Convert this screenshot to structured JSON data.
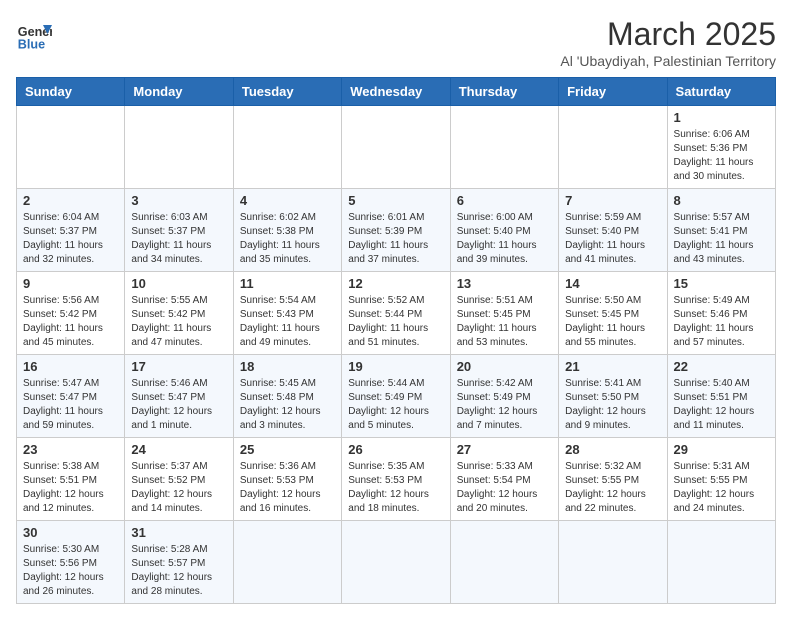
{
  "header": {
    "logo_text_general": "General",
    "logo_text_blue": "Blue",
    "month_title": "March 2025",
    "subtitle": "Al 'Ubaydiyah, Palestinian Territory"
  },
  "weekdays": [
    "Sunday",
    "Monday",
    "Tuesday",
    "Wednesday",
    "Thursday",
    "Friday",
    "Saturday"
  ],
  "weeks": [
    [
      {
        "day": "",
        "sunrise": "",
        "sunset": "",
        "daylight": ""
      },
      {
        "day": "",
        "sunrise": "",
        "sunset": "",
        "daylight": ""
      },
      {
        "day": "",
        "sunrise": "",
        "sunset": "",
        "daylight": ""
      },
      {
        "day": "",
        "sunrise": "",
        "sunset": "",
        "daylight": ""
      },
      {
        "day": "",
        "sunrise": "",
        "sunset": "",
        "daylight": ""
      },
      {
        "day": "",
        "sunrise": "",
        "sunset": "",
        "daylight": ""
      },
      {
        "day": "1",
        "sunrise": "Sunrise: 6:06 AM",
        "sunset": "Sunset: 5:36 PM",
        "daylight": "Daylight: 11 hours and 30 minutes."
      }
    ],
    [
      {
        "day": "2",
        "sunrise": "Sunrise: 6:04 AM",
        "sunset": "Sunset: 5:37 PM",
        "daylight": "Daylight: 11 hours and 32 minutes."
      },
      {
        "day": "3",
        "sunrise": "Sunrise: 6:03 AM",
        "sunset": "Sunset: 5:37 PM",
        "daylight": "Daylight: 11 hours and 34 minutes."
      },
      {
        "day": "4",
        "sunrise": "Sunrise: 6:02 AM",
        "sunset": "Sunset: 5:38 PM",
        "daylight": "Daylight: 11 hours and 35 minutes."
      },
      {
        "day": "5",
        "sunrise": "Sunrise: 6:01 AM",
        "sunset": "Sunset: 5:39 PM",
        "daylight": "Daylight: 11 hours and 37 minutes."
      },
      {
        "day": "6",
        "sunrise": "Sunrise: 6:00 AM",
        "sunset": "Sunset: 5:40 PM",
        "daylight": "Daylight: 11 hours and 39 minutes."
      },
      {
        "day": "7",
        "sunrise": "Sunrise: 5:59 AM",
        "sunset": "Sunset: 5:40 PM",
        "daylight": "Daylight: 11 hours and 41 minutes."
      },
      {
        "day": "8",
        "sunrise": "Sunrise: 5:57 AM",
        "sunset": "Sunset: 5:41 PM",
        "daylight": "Daylight: 11 hours and 43 minutes."
      }
    ],
    [
      {
        "day": "9",
        "sunrise": "Sunrise: 5:56 AM",
        "sunset": "Sunset: 5:42 PM",
        "daylight": "Daylight: 11 hours and 45 minutes."
      },
      {
        "day": "10",
        "sunrise": "Sunrise: 5:55 AM",
        "sunset": "Sunset: 5:42 PM",
        "daylight": "Daylight: 11 hours and 47 minutes."
      },
      {
        "day": "11",
        "sunrise": "Sunrise: 5:54 AM",
        "sunset": "Sunset: 5:43 PM",
        "daylight": "Daylight: 11 hours and 49 minutes."
      },
      {
        "day": "12",
        "sunrise": "Sunrise: 5:52 AM",
        "sunset": "Sunset: 5:44 PM",
        "daylight": "Daylight: 11 hours and 51 minutes."
      },
      {
        "day": "13",
        "sunrise": "Sunrise: 5:51 AM",
        "sunset": "Sunset: 5:45 PM",
        "daylight": "Daylight: 11 hours and 53 minutes."
      },
      {
        "day": "14",
        "sunrise": "Sunrise: 5:50 AM",
        "sunset": "Sunset: 5:45 PM",
        "daylight": "Daylight: 11 hours and 55 minutes."
      },
      {
        "day": "15",
        "sunrise": "Sunrise: 5:49 AM",
        "sunset": "Sunset: 5:46 PM",
        "daylight": "Daylight: 11 hours and 57 minutes."
      }
    ],
    [
      {
        "day": "16",
        "sunrise": "Sunrise: 5:47 AM",
        "sunset": "Sunset: 5:47 PM",
        "daylight": "Daylight: 11 hours and 59 minutes."
      },
      {
        "day": "17",
        "sunrise": "Sunrise: 5:46 AM",
        "sunset": "Sunset: 5:47 PM",
        "daylight": "Daylight: 12 hours and 1 minute."
      },
      {
        "day": "18",
        "sunrise": "Sunrise: 5:45 AM",
        "sunset": "Sunset: 5:48 PM",
        "daylight": "Daylight: 12 hours and 3 minutes."
      },
      {
        "day": "19",
        "sunrise": "Sunrise: 5:44 AM",
        "sunset": "Sunset: 5:49 PM",
        "daylight": "Daylight: 12 hours and 5 minutes."
      },
      {
        "day": "20",
        "sunrise": "Sunrise: 5:42 AM",
        "sunset": "Sunset: 5:49 PM",
        "daylight": "Daylight: 12 hours and 7 minutes."
      },
      {
        "day": "21",
        "sunrise": "Sunrise: 5:41 AM",
        "sunset": "Sunset: 5:50 PM",
        "daylight": "Daylight: 12 hours and 9 minutes."
      },
      {
        "day": "22",
        "sunrise": "Sunrise: 5:40 AM",
        "sunset": "Sunset: 5:51 PM",
        "daylight": "Daylight: 12 hours and 11 minutes."
      }
    ],
    [
      {
        "day": "23",
        "sunrise": "Sunrise: 5:38 AM",
        "sunset": "Sunset: 5:51 PM",
        "daylight": "Daylight: 12 hours and 12 minutes."
      },
      {
        "day": "24",
        "sunrise": "Sunrise: 5:37 AM",
        "sunset": "Sunset: 5:52 PM",
        "daylight": "Daylight: 12 hours and 14 minutes."
      },
      {
        "day": "25",
        "sunrise": "Sunrise: 5:36 AM",
        "sunset": "Sunset: 5:53 PM",
        "daylight": "Daylight: 12 hours and 16 minutes."
      },
      {
        "day": "26",
        "sunrise": "Sunrise: 5:35 AM",
        "sunset": "Sunset: 5:53 PM",
        "daylight": "Daylight: 12 hours and 18 minutes."
      },
      {
        "day": "27",
        "sunrise": "Sunrise: 5:33 AM",
        "sunset": "Sunset: 5:54 PM",
        "daylight": "Daylight: 12 hours and 20 minutes."
      },
      {
        "day": "28",
        "sunrise": "Sunrise: 5:32 AM",
        "sunset": "Sunset: 5:55 PM",
        "daylight": "Daylight: 12 hours and 22 minutes."
      },
      {
        "day": "29",
        "sunrise": "Sunrise: 5:31 AM",
        "sunset": "Sunset: 5:55 PM",
        "daylight": "Daylight: 12 hours and 24 minutes."
      }
    ],
    [
      {
        "day": "30",
        "sunrise": "Sunrise: 5:30 AM",
        "sunset": "Sunset: 5:56 PM",
        "daylight": "Daylight: 12 hours and 26 minutes."
      },
      {
        "day": "31",
        "sunrise": "Sunrise: 5:28 AM",
        "sunset": "Sunset: 5:57 PM",
        "daylight": "Daylight: 12 hours and 28 minutes."
      },
      {
        "day": "",
        "sunrise": "",
        "sunset": "",
        "daylight": ""
      },
      {
        "day": "",
        "sunrise": "",
        "sunset": "",
        "daylight": ""
      },
      {
        "day": "",
        "sunrise": "",
        "sunset": "",
        "daylight": ""
      },
      {
        "day": "",
        "sunrise": "",
        "sunset": "",
        "daylight": ""
      },
      {
        "day": "",
        "sunrise": "",
        "sunset": "",
        "daylight": ""
      }
    ]
  ]
}
